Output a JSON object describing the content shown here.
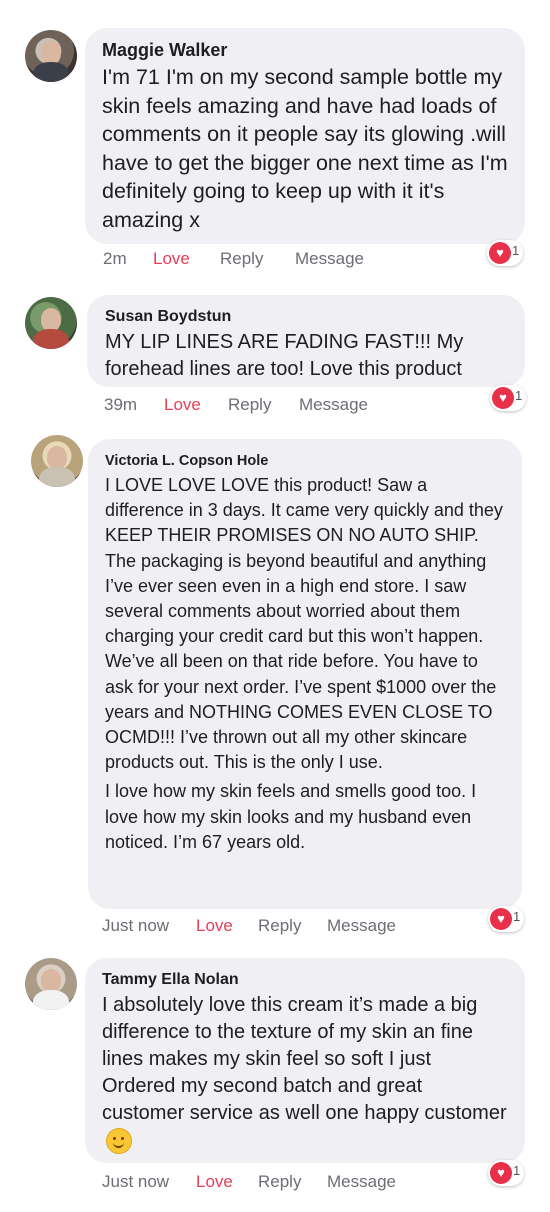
{
  "comments": [
    {
      "name": "Maggie Walker",
      "text": "I'm 71  I'm on my second sample bottle my skin feels amazing and have had loads  of comments on it people say its glowing .will have to get the bigger one next time as I'm definitely going to keep up with it it's amazing x",
      "time": "2m",
      "love": "Love",
      "reply": "Reply",
      "message": "Message",
      "reaction_count": "1",
      "reaction_icon": "heart-icon"
    },
    {
      "name": "Susan Boydstun",
      "text": "MY LIP LINES ARE FADING FAST!!!  My forehead lines are too!  Love this product",
      "time": "39m",
      "love": "Love",
      "reply": "Reply",
      "message": "Message",
      "reaction_count": "1",
      "reaction_icon": "heart-icon"
    },
    {
      "name": "Victoria L. Copson Hole",
      "text": "I LOVE LOVE LOVE this product! Saw a difference in 3 days. It came very quickly and they KEEP THEIR PROMISES ON NO AUTO SHIP. The packaging is beyond beautiful and anything I’ve ever seen even in a high end store. I saw several comments about worried about them charging your credit card but this won’t happen. We’ve all been on that ride before. You have to ask for your next order. I’ve spent $1000 over the years and NOTHING COMES EVEN CLOSE TO OCMD!!! I’ve thrown out all my other skincare products out. This is the only I use.",
      "text2": "I love how my skin feels and smells good too. I love how my skin looks and my husband even noticed. I’m 67 years old.",
      "time": "Just now",
      "love": "Love",
      "reply": "Reply",
      "message": "Message",
      "reaction_count": "1",
      "reaction_icon": "heart-icon"
    },
    {
      "name": "Tammy Ella Nolan",
      "text": "I absolutely love this cream it’s made a big difference to the texture of my skin an fine lines makes my skin feel so soft I  just Ordered my second batch and great customer service as well one happy customer",
      "emoji": "smiling-face-icon",
      "time": "Just now",
      "love": "Love",
      "reply": "Reply",
      "message": "Message",
      "reaction_count": "1",
      "reaction_icon": "heart-icon"
    }
  ],
  "colors": {
    "bubble": "#f0f0f4",
    "love": "#e83f57",
    "meta": "#6b6e74",
    "heart": "#e8304a"
  }
}
